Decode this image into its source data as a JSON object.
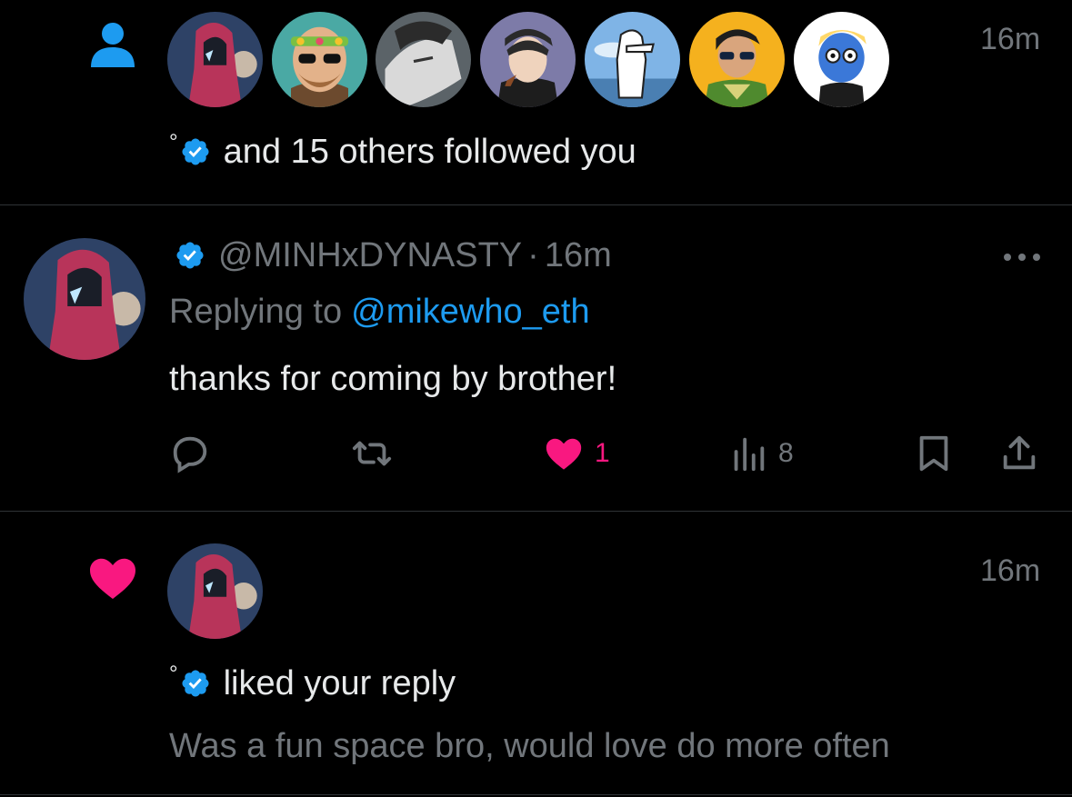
{
  "colors": {
    "background": "#000000",
    "text": "#e7e9ea",
    "muted": "#71767b",
    "link": "#1d9bf0",
    "verified": "#1d9bf0",
    "like": "#f91880",
    "divider": "#2f3336"
  },
  "follow_notification": {
    "icon": "person-icon",
    "time": "16m",
    "avatars": [
      "red-hood-avatar",
      "bearded-man-avatar",
      "grayscale-man-avatar",
      "pipe-man-avatar",
      "white-duck-avatar",
      "sunglasses-boy-avatar",
      "blue-character-avatar"
    ],
    "text": "and 15 others followed you"
  },
  "reply_tweet": {
    "handle": "@MINHxDYNASTY",
    "separator": "·",
    "time": "16m",
    "replying_to_label": "Replying to",
    "replying_to_handle": "@mikewho_eth",
    "body": "thanks for coming by brother!",
    "more_icon": "more-dots-icon",
    "actions": {
      "reply_icon": "reply-icon",
      "retweet_icon": "retweet-icon",
      "like_icon": "heart-icon",
      "like_count": "1",
      "views_icon": "views-icon",
      "views_count": "8",
      "bookmark_icon": "bookmark-icon",
      "share_icon": "share-icon"
    }
  },
  "like_notification": {
    "icon": "heart-icon",
    "time": "16m",
    "text": "liked your reply",
    "quoted_text": "Was a fun space bro, would love do more often"
  }
}
